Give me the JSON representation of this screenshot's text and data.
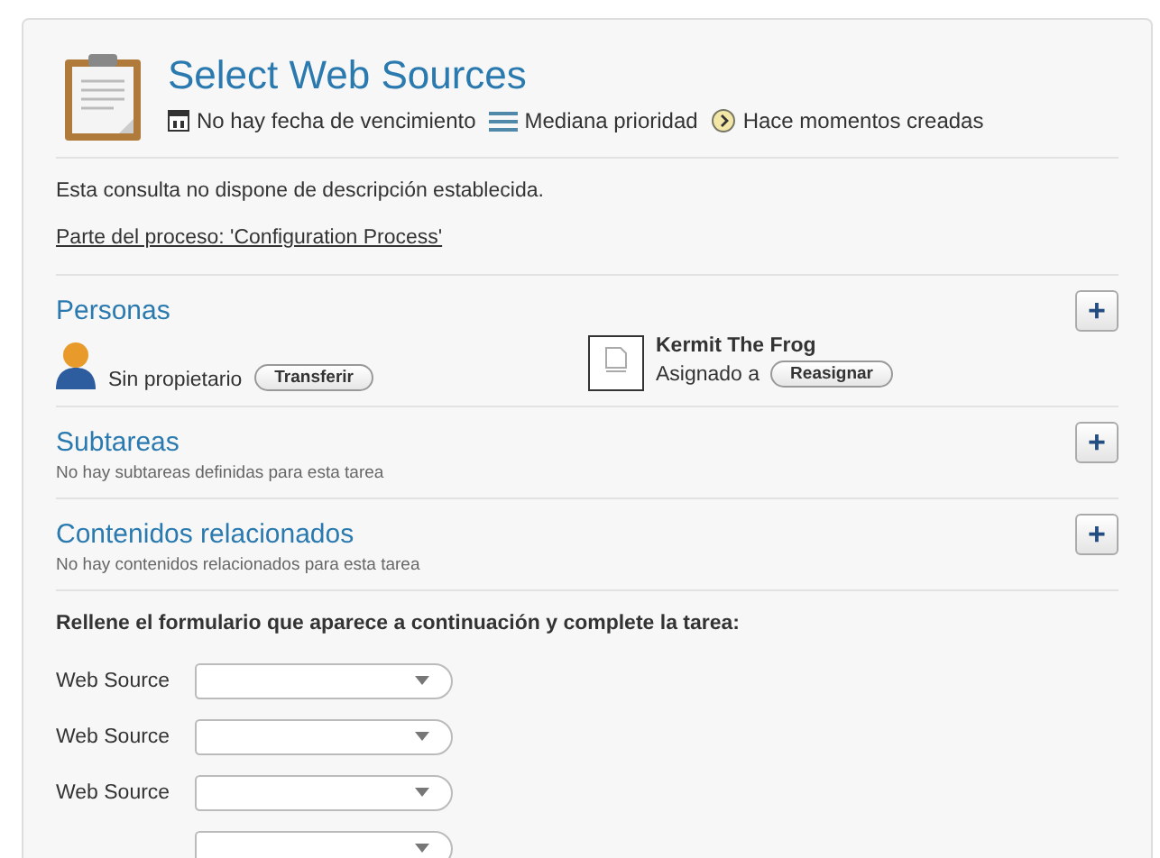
{
  "task": {
    "title": "Select Web Sources",
    "meta": [
      {
        "kind": "calendar",
        "text": "No hay fecha de vencimiento"
      },
      {
        "kind": "priority",
        "text": "Mediana prioridad"
      },
      {
        "kind": "clock",
        "text": "Hace momentos creadas"
      }
    ],
    "description": "Esta consulta no dispone de descripción establecida.",
    "process_link": "Parte del proceso: 'Configuration Process'"
  },
  "people": {
    "title": "Personas",
    "add_button": "+",
    "owner": {
      "text": "Sin propietario",
      "button": "Transferir"
    },
    "assignee": {
      "name": "Kermit The Frog",
      "text": "Asignado a",
      "button": "Reasignar"
    }
  },
  "sections": [
    {
      "title": "Subtareas",
      "add_button": "+",
      "empty": "No hay subtareas definidas para esta tarea"
    },
    {
      "title": "Contenidos relacionados",
      "add_button": "+",
      "empty": "No hay contenidos relacionados para esta tarea"
    }
  ],
  "form": {
    "intro": "Rellene el formulario que aparece a continuación y complete la tarea:",
    "fields": [
      {
        "label": "Web Source"
      },
      {
        "label": "Web Source"
      },
      {
        "label": "Web Source"
      },
      {
        "kind": "cut-off"
      }
    ]
  }
}
